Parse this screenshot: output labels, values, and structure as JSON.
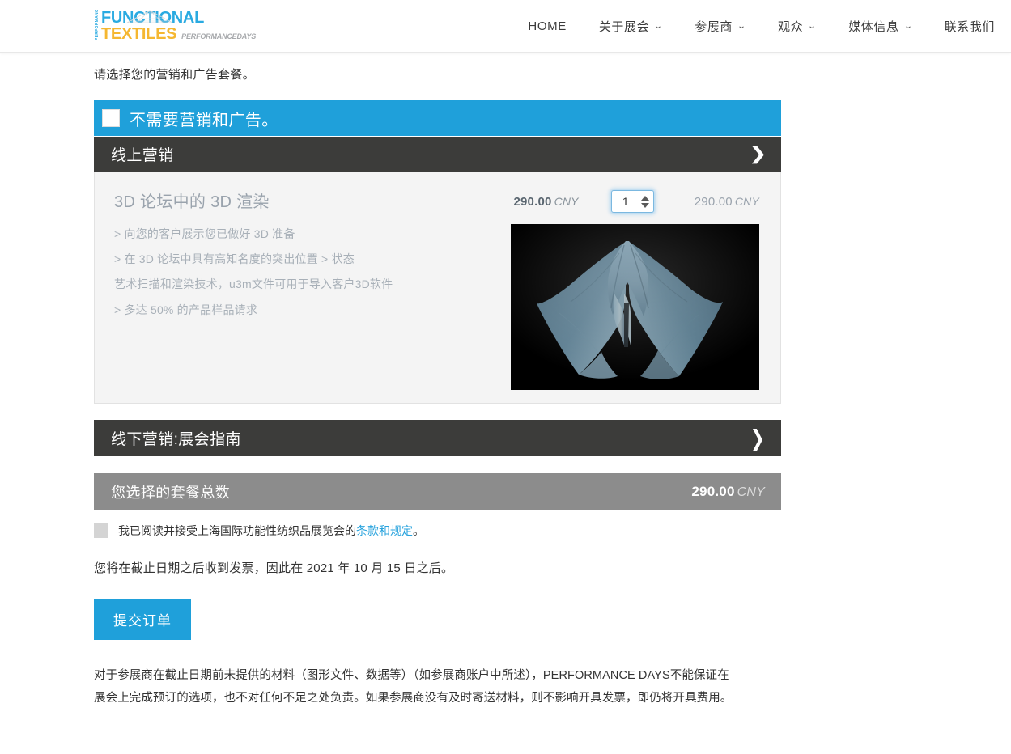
{
  "header": {
    "logo": {
      "vertical_text": "PERFORMANCEDAYS",
      "line1": "FUNCTIONAL",
      "line2": "TEXTILES",
      "tagline": "PERFORMANCEDAYS"
    },
    "nav": [
      {
        "label": "HOME",
        "has_caret": false
      },
      {
        "label": "关于展会",
        "has_caret": true
      },
      {
        "label": "参展商",
        "has_caret": true
      },
      {
        "label": "观众",
        "has_caret": true
      },
      {
        "label": "媒体信息",
        "has_caret": true
      },
      {
        "label": "联系我们",
        "has_caret": false
      }
    ],
    "caret_glyph": "⌄"
  },
  "main": {
    "intro": "请选择您的营销和广告套餐。",
    "no_marketing": {
      "label": "不需要营销和广告。",
      "checked": false
    },
    "section_online": {
      "title": "线上营销",
      "expanded": true,
      "chevron": "❯"
    },
    "product": {
      "title": "3D 论坛中的 3D 渲染",
      "bullets": [
        "> 向您的客户展示您已做好 3D 准备",
        "> 在 3D 论坛中具有高知名度的突出位置 > 状态",
        "艺术扫描和渲染技术，u3m文件可用于导入客户3D软件",
        "> 多达 50% 的产品样品请求"
      ],
      "unit_price": "290.00",
      "unit_currency": "CNY",
      "quantity": "1",
      "line_total": "290.00",
      "line_currency": "CNY",
      "image_alt": "3D 渲染的蓝灰色织物"
    },
    "section_offline": {
      "title": "线下营销:展会指南",
      "expanded": false,
      "chevron": "❯"
    },
    "total": {
      "label": "您选择的套餐总数",
      "amount": "290.00",
      "currency": "CNY"
    },
    "terms": {
      "checked": false,
      "text_before": "我已阅读并接受上海国际功能性纺织品展览会的",
      "link_text": "条款和规定",
      "text_after": "。"
    },
    "invoice_note": "您将在截止日期之后收到发票，因此在 2021 年 10 月 15 日之后。",
    "submit_label": "提交订单",
    "footnote": "对于参展商在截止日期前未提供的材料（图形文件、数据等）（如参展商账户中所述），PERFORMANCE DAYS不能保证在展会上完成预订的选项，也不对任何不足之处负责。如果参展商没有及时寄送材料，则不影响开具发票，即仍将开具费用。"
  },
  "colors": {
    "accent_blue": "#1fa0da",
    "logo_blue": "#29aae1",
    "logo_yellow": "#f5b731",
    "dark_bar": "#3c3c3a",
    "gray_bar": "#8c8c8c",
    "panel_bg": "#f4f4f4",
    "link_blue": "#29a3dd"
  }
}
